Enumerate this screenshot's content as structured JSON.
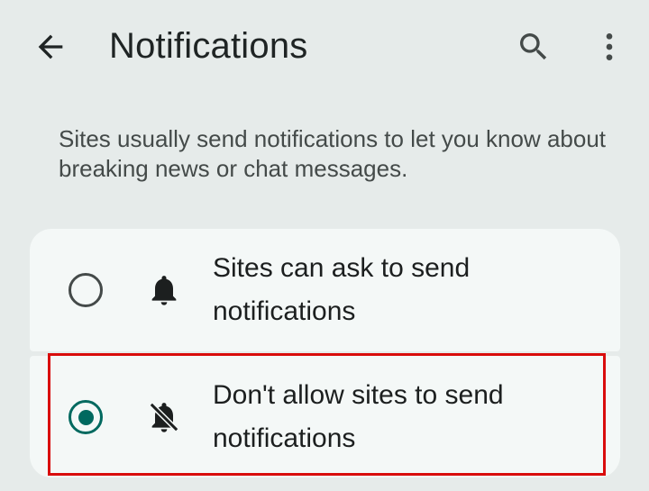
{
  "header": {
    "title": "Notifications",
    "back_icon": "arrow-back-icon",
    "search_icon": "search-icon",
    "more_icon": "more-vert-icon"
  },
  "description": "Sites usually send notifications to let you know about breaking news or chat messages.",
  "options": [
    {
      "label": "Sites can ask to send notifications",
      "icon": "bell-icon",
      "selected": false
    },
    {
      "label": "Don't allow sites to send notifications",
      "icon": "bell-off-icon",
      "selected": true
    }
  ],
  "colors": {
    "background": "#e6ebea",
    "card": "#f4f8f7",
    "accent": "#00695f",
    "highlight": "#d90c0c"
  }
}
